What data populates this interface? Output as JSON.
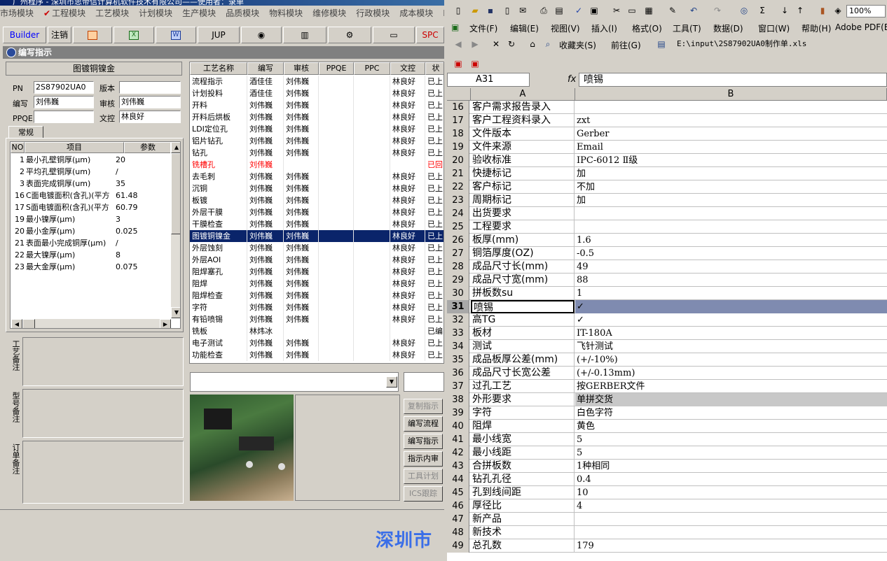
{
  "left_app": {
    "title": "广州程序 - 深圳市思帝信计算机软件技术有限公司——使用者：录单",
    "menu": [
      "市场模块",
      "工程模块",
      "工艺模块",
      "计划模块",
      "生产模块",
      "品质模块",
      "物料模块",
      "维修模块",
      "行政模块",
      "成本模块",
      "I"
    ],
    "toolbar": {
      "builder": "Builder",
      "logout": "注销",
      "jup": "JUP",
      "spc": "SPC"
    },
    "subtitle": "编写指示",
    "process_name": "图镀铜镍金",
    "form": {
      "pn_label": "PN",
      "pn_value": "2S87902UA0",
      "version_label": "版本",
      "version_value": "",
      "writer_label": "编写",
      "writer_value": "刘伟巍",
      "review_label": "审核",
      "review_value": "刘伟巍",
      "ppqe_label": "PPQE",
      "ppqe_value": "",
      "doc_label": "文控",
      "doc_value": "林良好"
    },
    "tab_label": "常规",
    "param_headers": [
      "NO",
      "项目",
      "参数"
    ],
    "params": [
      {
        "no": "1",
        "item": "最小孔壁铜厚(μm)",
        "value": "20"
      },
      {
        "no": "2",
        "item": "平均孔壁铜厚(um)",
        "value": "/"
      },
      {
        "no": "3",
        "item": "表面完成铜厚(um)",
        "value": "35"
      },
      {
        "no": "16",
        "item": "C面电镀面积(含孔)(平方",
        "value": "61.48"
      },
      {
        "no": "17",
        "item": "S面电镀面积(含孔)(平方",
        "value": "60.79"
      },
      {
        "no": "19",
        "item": "最小镍厚(μm)",
        "value": "3"
      },
      {
        "no": "20",
        "item": "最小金厚(μm)",
        "value": "0.025"
      },
      {
        "no": "21",
        "item": "表面最小完成铜厚(μm)",
        "value": "/"
      },
      {
        "no": "22",
        "item": "最大镍厚(μm)",
        "value": "8"
      },
      {
        "no": "23",
        "item": "最大金厚(μm)",
        "value": "0.075"
      }
    ],
    "notes": [
      "工艺备注",
      "型号备注",
      "订单备注"
    ],
    "proc_headers": [
      "工艺名称",
      "编写",
      "审核",
      "PPQE",
      "PPC",
      "文控",
      "状"
    ],
    "processes": [
      {
        "name": "流程指示",
        "w": "酒佳佳",
        "r": "刘伟巍",
        "p": "",
        "c": "",
        "d": "林良好",
        "s": "已上"
      },
      {
        "name": "计划投料",
        "w": "酒佳佳",
        "r": "刘伟巍",
        "p": "",
        "c": "",
        "d": "林良好",
        "s": "已上"
      },
      {
        "name": "开料",
        "w": "刘伟巍",
        "r": "刘伟巍",
        "p": "",
        "c": "",
        "d": "林良好",
        "s": "已上"
      },
      {
        "name": "开料后烘板",
        "w": "刘伟巍",
        "r": "刘伟巍",
        "p": "",
        "c": "",
        "d": "林良好",
        "s": "已上"
      },
      {
        "name": "LDI定位孔",
        "w": "刘伟巍",
        "r": "刘伟巍",
        "p": "",
        "c": "",
        "d": "林良好",
        "s": "已上"
      },
      {
        "name": "铝片钻孔",
        "w": "刘伟巍",
        "r": "刘伟巍",
        "p": "",
        "c": "",
        "d": "林良好",
        "s": "已上"
      },
      {
        "name": "钻孔",
        "w": "刘伟巍",
        "r": "刘伟巍",
        "p": "",
        "c": "",
        "d": "林良好",
        "s": "已上"
      },
      {
        "name": "铣槽孔",
        "w": "刘伟巍",
        "r": "",
        "p": "",
        "c": "",
        "d": "",
        "s": "已回"
      },
      {
        "name": "去毛刺",
        "w": "刘伟巍",
        "r": "刘伟巍",
        "p": "",
        "c": "",
        "d": "林良好",
        "s": "已上"
      },
      {
        "name": "沉铜",
        "w": "刘伟巍",
        "r": "刘伟巍",
        "p": "",
        "c": "",
        "d": "林良好",
        "s": "已上"
      },
      {
        "name": "板镀",
        "w": "刘伟巍",
        "r": "刘伟巍",
        "p": "",
        "c": "",
        "d": "林良好",
        "s": "已上"
      },
      {
        "name": "外层干膜",
        "w": "刘伟巍",
        "r": "刘伟巍",
        "p": "",
        "c": "",
        "d": "林良好",
        "s": "已上"
      },
      {
        "name": "干膜检查",
        "w": "刘伟巍",
        "r": "刘伟巍",
        "p": "",
        "c": "",
        "d": "林良好",
        "s": "已上"
      },
      {
        "name": "图镀铜镍金",
        "w": "刘伟巍",
        "r": "刘伟巍",
        "p": "",
        "c": "",
        "d": "林良好",
        "s": "已上"
      },
      {
        "name": "外层蚀刻",
        "w": "刘伟巍",
        "r": "刘伟巍",
        "p": "",
        "c": "",
        "d": "林良好",
        "s": "已上"
      },
      {
        "name": "外层AOI",
        "w": "刘伟巍",
        "r": "刘伟巍",
        "p": "",
        "c": "",
        "d": "林良好",
        "s": "已上"
      },
      {
        "name": "阻焊塞孔",
        "w": "刘伟巍",
        "r": "刘伟巍",
        "p": "",
        "c": "",
        "d": "林良好",
        "s": "已上"
      },
      {
        "name": "阻焊",
        "w": "刘伟巍",
        "r": "刘伟巍",
        "p": "",
        "c": "",
        "d": "林良好",
        "s": "已上"
      },
      {
        "name": "阻焊检查",
        "w": "刘伟巍",
        "r": "刘伟巍",
        "p": "",
        "c": "",
        "d": "林良好",
        "s": "已上"
      },
      {
        "name": "字符",
        "w": "刘伟巍",
        "r": "刘伟巍",
        "p": "",
        "c": "",
        "d": "林良好",
        "s": "已上"
      },
      {
        "name": "有铅喷锡",
        "w": "刘伟巍",
        "r": "刘伟巍",
        "p": "",
        "c": "",
        "d": "林良好",
        "s": "已上"
      },
      {
        "name": "铣板",
        "w": "林炜冰",
        "r": "",
        "p": "",
        "c": "",
        "d": "",
        "s": "已编"
      },
      {
        "name": "电子测试",
        "w": "刘伟巍",
        "r": "刘伟巍",
        "p": "",
        "c": "",
        "d": "林良好",
        "s": "已上"
      },
      {
        "name": "功能检查",
        "w": "刘伟巍",
        "r": "刘伟巍",
        "p": "",
        "c": "",
        "d": "林良好",
        "s": "已上"
      }
    ],
    "action_buttons": [
      "复制指示",
      "编写流程",
      "编写指示",
      "指示内审",
      "工具计划",
      "ICS跟踪"
    ],
    "status_text": "深圳市"
  },
  "excel": {
    "menu": [
      "文件(F)",
      "编辑(E)",
      "视图(V)",
      "插入(I)",
      "格式(O)",
      "工具(T)",
      "数据(D)",
      "窗口(W)",
      "帮助(H)",
      "Adobe PDF(B)"
    ],
    "zoom": "100%",
    "favorites": "收藏夹(S)",
    "goto": "前往(G)",
    "path": "E:\\input\\2S87902UA0制作单.xls",
    "namebox": "A31",
    "fx": "fx",
    "formula": "喷锡",
    "col_a": "A",
    "col_b": "B",
    "rows": [
      {
        "n": "16",
        "a": "客户需求报告录入",
        "b": ""
      },
      {
        "n": "17",
        "a": "客户工程资料录入",
        "b": "zxt"
      },
      {
        "n": "18",
        "a": "文件版本",
        "b": "Gerber"
      },
      {
        "n": "19",
        "a": "文件来源",
        "b": "Email"
      },
      {
        "n": "20",
        "a": "验收标准",
        "b": "IPC-6012 Ⅱ级"
      },
      {
        "n": "21",
        "a": "快捷标记",
        "b": "加"
      },
      {
        "n": "22",
        "a": "客户标记",
        "b": "不加"
      },
      {
        "n": "23",
        "a": "周期标记",
        "b": "加"
      },
      {
        "n": "24",
        "a": "出货要求",
        "b": ""
      },
      {
        "n": "25",
        "a": "工程要求",
        "b": ""
      },
      {
        "n": "26",
        "a": "板厚(mm)",
        "b": "1.6"
      },
      {
        "n": "27",
        "a": "铜箔厚度(OZ)",
        "b": "-0.5"
      },
      {
        "n": "28",
        "a": "成品尺寸长(mm)",
        "b": "49"
      },
      {
        "n": "29",
        "a": "成品尺寸宽(mm)",
        "b": "88"
      },
      {
        "n": "30",
        "a": "拼板数su",
        "b": "1"
      },
      {
        "n": "31",
        "a": "喷锡",
        "b": "✓"
      },
      {
        "n": "32",
        "a": "高TG",
        "b": "✓"
      },
      {
        "n": "33",
        "a": "板材",
        "b": "IT-180A"
      },
      {
        "n": "34",
        "a": "测试",
        "b": "飞针测试"
      },
      {
        "n": "35",
        "a": "成品板厚公差(mm)",
        "b": "(+/-10%)"
      },
      {
        "n": "36",
        "a": "成品尺寸长宽公差",
        "b": "(+/-0.13mm)"
      },
      {
        "n": "37",
        "a": "过孔工艺",
        "b": "按GERBER文件"
      },
      {
        "n": "38",
        "a": "外形要求",
        "b": "单拼交货"
      },
      {
        "n": "39",
        "a": "字符",
        "b": "白色字符"
      },
      {
        "n": "40",
        "a": "阻焊",
        "b": "黄色"
      },
      {
        "n": "41",
        "a": "最小线宽",
        "b": "5"
      },
      {
        "n": "42",
        "a": "最小线距",
        "b": "5"
      },
      {
        "n": "43",
        "a": "合拼板数",
        "b": "1种相同"
      },
      {
        "n": "44",
        "a": "钻孔孔径",
        "b": "0.4"
      },
      {
        "n": "45",
        "a": "孔到线间距",
        "b": "10"
      },
      {
        "n": "46",
        "a": "厚径比",
        "b": "4"
      },
      {
        "n": "47",
        "a": "新产品",
        "b": ""
      },
      {
        "n": "48",
        "a": "新技术",
        "b": ""
      },
      {
        "n": "49",
        "a": "总孔数",
        "b": "179"
      }
    ]
  }
}
